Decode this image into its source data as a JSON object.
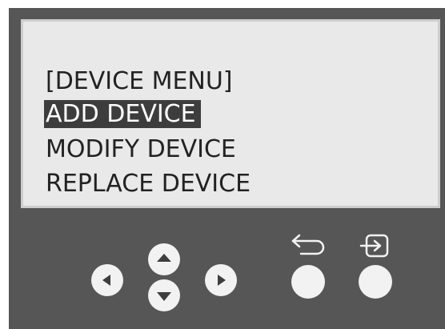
{
  "device_menu": {
    "title": "[DEVICE MENU]",
    "items": [
      {
        "label": "ADD DEVICE",
        "selected": true
      },
      {
        "label": "MODIFY DEVICE",
        "selected": false
      },
      {
        "label": "REPLACE DEVICE",
        "selected": false
      }
    ]
  },
  "controls": {
    "left_icon": "triangle-left-icon",
    "up_icon": "triangle-up-icon",
    "down_icon": "triangle-down-icon",
    "right_icon": "triangle-right-icon",
    "back_icon": "return-arrow-icon",
    "enter_icon": "enter-icon"
  },
  "colors": {
    "panel": "#565656",
    "screen": "#e9e9e9",
    "highlight": "#3d3d3d",
    "button": "#f2f2f2"
  }
}
